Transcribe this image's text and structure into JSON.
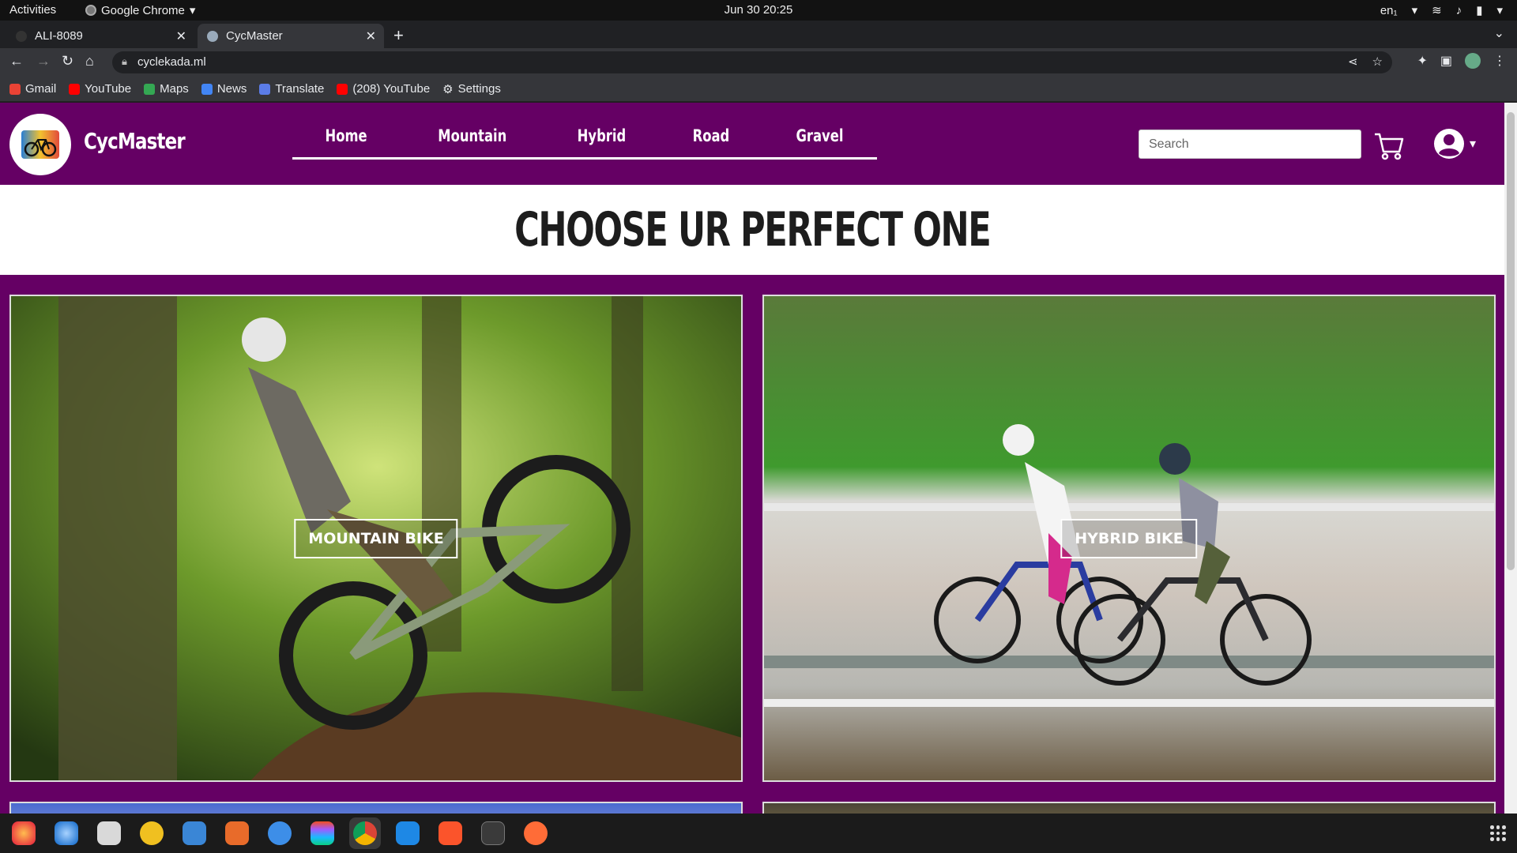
{
  "system_bar": {
    "activities": "Activities",
    "app_name": "Google Chrome",
    "clock": "Jun 30  20:25",
    "keyboard_layout": "en₁"
  },
  "browser": {
    "tabs": [
      {
        "title": "ALI-8089",
        "active": false
      },
      {
        "title": "CycMaster",
        "active": true
      }
    ],
    "url": "cyclekada.ml",
    "bookmarks": [
      {
        "label": "Gmail",
        "icon": "gmail-icon",
        "color": "#ea4335"
      },
      {
        "label": "YouTube",
        "icon": "youtube-icon",
        "color": "#ff0000"
      },
      {
        "label": "Maps",
        "icon": "maps-icon",
        "color": "#34a853"
      },
      {
        "label": "News",
        "icon": "news-icon",
        "color": "#4285f4"
      },
      {
        "label": "Translate",
        "icon": "translate-icon",
        "color": "#4285f4"
      },
      {
        "label": "(208) YouTube",
        "icon": "youtube-icon",
        "color": "#ff0000"
      },
      {
        "label": "Settings",
        "icon": "gear-icon",
        "color": "#e8eaed"
      }
    ]
  },
  "site": {
    "brand": "CycMaster",
    "nav": [
      "Home",
      "Mountain",
      "Hybrid",
      "Road",
      "Gravel"
    ],
    "search_placeholder": "Search",
    "headline": "CHOOSE UR PERFECT ONE",
    "cards": [
      {
        "label": "MOUNTAIN BIKE",
        "image": "mountain-bike-rider-forest"
      },
      {
        "label": "HYBRID BIKE",
        "image": "hybrid-bike-riders-road"
      }
    ],
    "colors": {
      "theme": "#650064",
      "headline": "#1d1d1d"
    }
  },
  "taskbar": {
    "apps": [
      "firefox-icon",
      "thunderbird-icon",
      "files-icon",
      "rhythmbox-icon",
      "writer-icon",
      "software-icon",
      "help-icon",
      "figma-icon",
      "chrome-icon",
      "vscode-icon",
      "brave-icon",
      "terminal-icon",
      "postman-icon"
    ]
  }
}
